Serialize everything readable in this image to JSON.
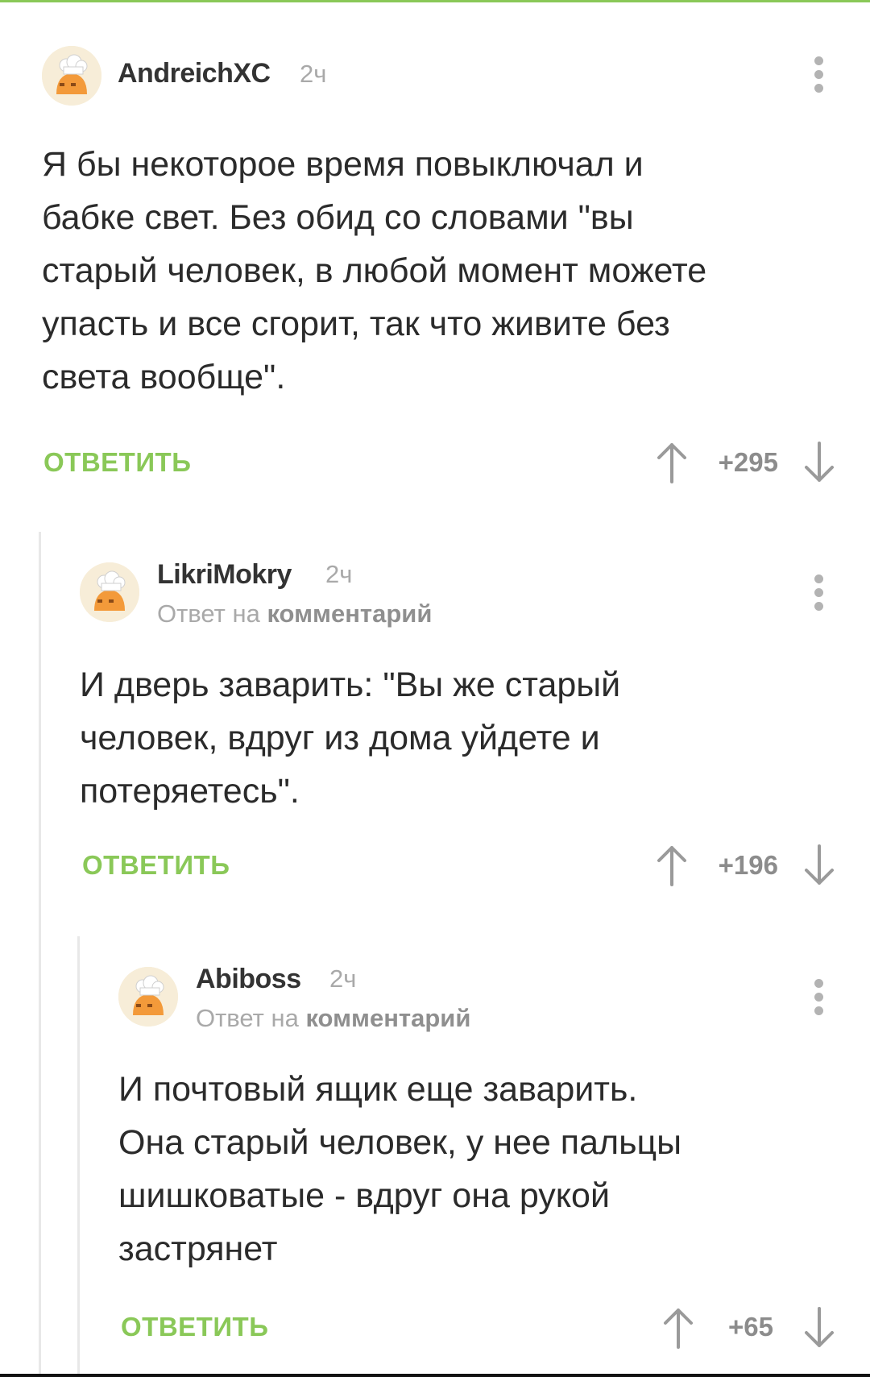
{
  "theme": {
    "accent": "#8ac858",
    "muted": "#a9a9a9"
  },
  "comments": [
    {
      "author": "AndreichXC",
      "time": "2ч",
      "reply_to": null,
      "text_lines": [
        "Я бы некоторое время повыключал и",
        "бабке свет. Без обид со словами \"вы",
        "старый человек, в любой момент можете",
        "упасть и все сгорит, так что живите без",
        "света вообще\"."
      ],
      "reply_label": "ОТВЕТИТЬ",
      "rating": "+295",
      "icons": {
        "avatar": "chef-avatar-icon",
        "more": "more-vertical-icon",
        "up": "arrow-up-icon",
        "down": "arrow-down-icon"
      }
    },
    {
      "author": "LikriMokry",
      "time": "2ч",
      "reply_to": {
        "prefix": "Ответ на",
        "link": "комментарий"
      },
      "text_lines": [
        "И дверь заварить: \"Вы же старый",
        "человек, вдруг из дома уйдете и",
        "потеряетесь\"."
      ],
      "reply_label": "ОТВЕТИТЬ",
      "rating": "+196"
    },
    {
      "author": "Abiboss",
      "time": "2ч",
      "reply_to": {
        "prefix": "Ответ на",
        "link": "комментарий"
      },
      "text_lines": [
        "И почтовый ящик еще заварить.",
        "Она старый человек, у нее пальцы",
        "шишковатые - вдруг она рукой",
        "застрянет"
      ],
      "reply_label": "ОТВЕТИТЬ",
      "rating": "+65"
    }
  ]
}
